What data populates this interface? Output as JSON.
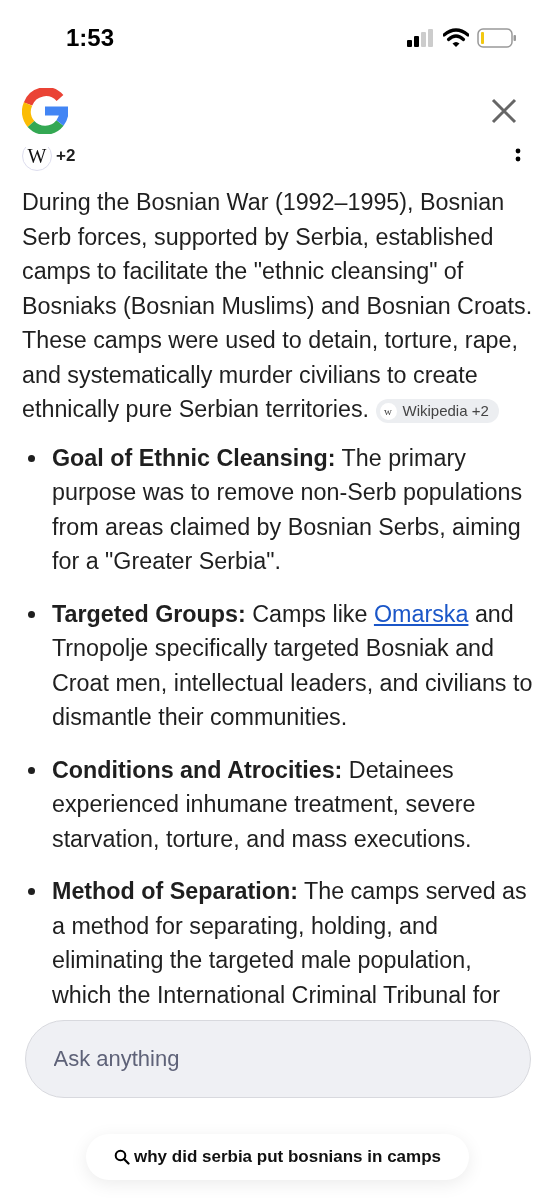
{
  "status_bar": {
    "time": "1:53"
  },
  "sources_row": {
    "icon_letter": "W",
    "count": "+2"
  },
  "intro": {
    "text": "During the Bosnian War (1992–1995), Bosnian Serb forces, supported by Serbia, established camps to facilitate the \"ethnic cleansing\" of Bosniaks (Bosnian Muslims) and Bosnian Croats. These camps were used to detain, torture, rape, and systematically murder civilians to create ethnically pure Serbian territories.",
    "chip_letter": "w",
    "source_chip": "Wikipedia +2"
  },
  "bullets": [
    {
      "title": "Goal of Ethnic Cleansing:",
      "segments": [
        {
          "kind": "text",
          "text": "The primary purpose was to remove non-Serb populations from areas claimed by Bosnian Serbs, aiming for a \"Greater Serbia\"."
        }
      ]
    },
    {
      "title": "Targeted Groups:",
      "segments": [
        {
          "kind": "text",
          "text": "Camps like "
        },
        {
          "kind": "link",
          "text": "Omarska"
        },
        {
          "kind": "text",
          "text": " and Trnopolje specifically targeted Bosniak and Croat men, intellectual leaders, and civilians to dismantle their communities."
        }
      ]
    },
    {
      "title": "Conditions and Atrocities:",
      "segments": [
        {
          "kind": "text",
          "text": "Detainees experienced inhumane treatment, severe starvation, torture, and mass executions."
        }
      ]
    },
    {
      "title": "Method of Separation:",
      "segments": [
        {
          "kind": "text",
          "text": "The camps served as a method for separating, holding, and eliminating the targeted male population, which the International Criminal Tribunal for"
        }
      ]
    }
  ],
  "ask_field": {
    "placeholder": "Ask anything"
  },
  "query_pill": {
    "text": "why did serbia put bosnians in camps"
  }
}
